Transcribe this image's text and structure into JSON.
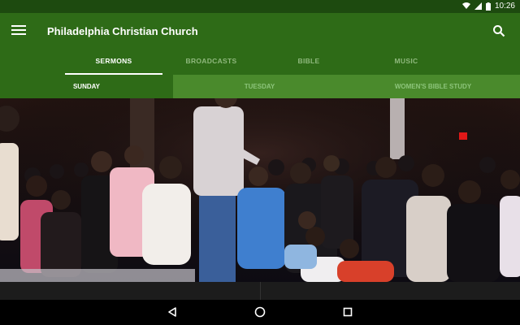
{
  "status": {
    "time": "10:26"
  },
  "app": {
    "title": "Philadelphia Christian Church"
  },
  "tabs": [
    {
      "label": "SERMONS",
      "active": true
    },
    {
      "label": "BROADCASTS",
      "active": false
    },
    {
      "label": "BIBLE",
      "active": false
    },
    {
      "label": "MUSIC",
      "active": false
    }
  ],
  "subtabs": [
    {
      "label": "SUNDAY",
      "active": true
    },
    {
      "label": "TUESDAY",
      "active": false
    },
    {
      "label": "WOMEN'S BIBLE STUDY",
      "active": false
    }
  ],
  "colors": {
    "status_bar": "#1d4a0f",
    "app_bar": "#2e6b17",
    "subtab_bar": "#4a8a2c",
    "inactive_tab_text": "#8fb87d"
  },
  "icons": {
    "menu": "hamburger-icon",
    "search": "search-icon",
    "wifi": "wifi-icon",
    "signal": "signal-icon",
    "battery": "battery-icon",
    "back": "back-icon",
    "home": "home-icon",
    "recents": "recents-icon"
  }
}
